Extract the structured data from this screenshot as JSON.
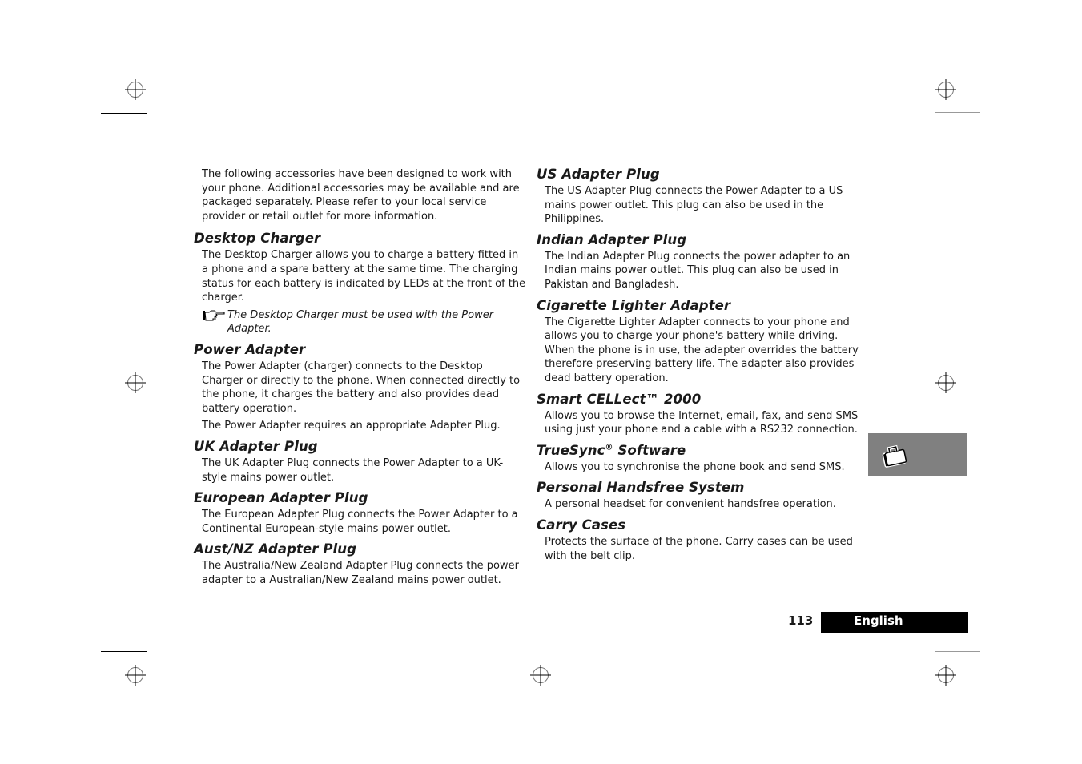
{
  "page": {
    "intro": "The following accessories have been designed to work with your phone. Additional accessories may be available and are packaged separately. Please refer to your local service provider or retail outlet for more information.",
    "left_column": [
      {
        "title": "Desktop Charger",
        "paragraphs": [
          "The Desktop Charger allows you to charge a battery fitted in a phone and a spare battery at the same time. The charging status for each battery is indicated by LEDs at the front of the charger."
        ],
        "note": "The Desktop Charger must be used with the Power Adapter.",
        "note_icon": "pointing-hand-icon"
      },
      {
        "title": "Power Adapter",
        "paragraphs": [
          "The Power Adapter (charger) connects to the Desktop Charger or directly to the phone. When connected directly to the phone, it charges the battery and also provides dead battery operation.",
          "The Power Adapter requires an appropriate Adapter Plug."
        ]
      },
      {
        "title": "UK Adapter Plug",
        "paragraphs": [
          "The UK Adapter Plug connects the Power Adapter to a UK-style mains power outlet."
        ]
      },
      {
        "title": "European Adapter Plug",
        "paragraphs": [
          "The European Adapter Plug connects the Power Adapter to a Continental European-style mains power outlet."
        ]
      },
      {
        "title": "Aust/NZ Adapter Plug",
        "paragraphs": [
          "The Australia/New Zealand Adapter Plug connects the power adapter to a Australian/New Zealand mains power outlet."
        ]
      }
    ],
    "right_column": [
      {
        "title": "US Adapter Plug",
        "paragraphs": [
          "The US Adapter Plug connects the Power Adapter to a US mains power outlet. This plug can also be used in the Philippines."
        ]
      },
      {
        "title": "Indian Adapter Plug",
        "paragraphs": [
          "The Indian Adapter Plug connects the power adapter to an Indian mains power outlet. This plug can also be used in Pakistan and Bangladesh."
        ]
      },
      {
        "title": "Cigarette Lighter Adapter",
        "paragraphs": [
          "The Cigarette Lighter Adapter connects to your phone and allows you to charge your phone's battery while driving. When the phone is in use, the adapter overrides the battery therefore preserving battery life. The adapter also provides dead battery operation."
        ]
      },
      {
        "title": "Smart CELLect™ 2000",
        "paragraphs": [
          "Allows you to browse the Internet, email, fax, and send SMS using just your phone and a cable with a RS232 connection."
        ]
      },
      {
        "title": "TrueSync",
        "title_sup": "®",
        "title_suffix": " Software",
        "paragraphs": [
          "Allows you to synchronise the phone book and send SMS."
        ]
      },
      {
        "title": "Personal Handsfree System",
        "paragraphs": [
          "A personal headset for convenient handsfree operation."
        ]
      },
      {
        "title": "Carry Cases",
        "paragraphs": [
          "Protects the surface of the phone. Carry cases can be used with the belt clip."
        ]
      }
    ],
    "side_tab": {
      "icon": "briefcase-icon",
      "color": "#808080"
    },
    "footer": {
      "page_number": "113",
      "language": "English"
    }
  }
}
